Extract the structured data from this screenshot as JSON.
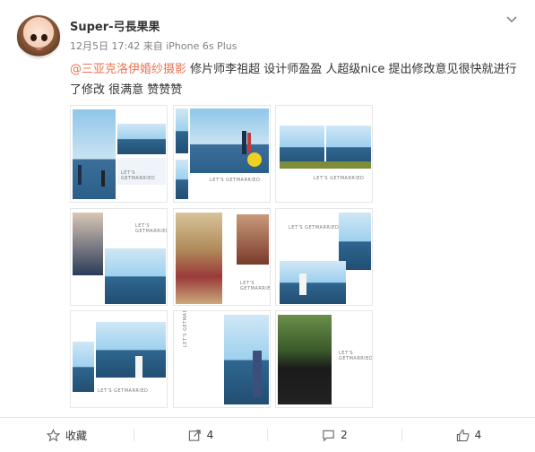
{
  "post": {
    "username": "Super-弓長果果",
    "time": "12月5日 17:42",
    "source_prefix": "来自",
    "source": "iPhone 6s Plus",
    "mention": "@三亚克洛伊婚纱摄影",
    "text": " 修片师李祖超 设计师盈盈 人超级nice 提出修改意见很快就进行了修改 很满意 赞赞赞",
    "tile_caption": "LET'S GETMARRIED"
  },
  "actions": {
    "favorite_label": "收藏",
    "repost_count": "4",
    "comment_count": "2",
    "like_count": "4"
  }
}
